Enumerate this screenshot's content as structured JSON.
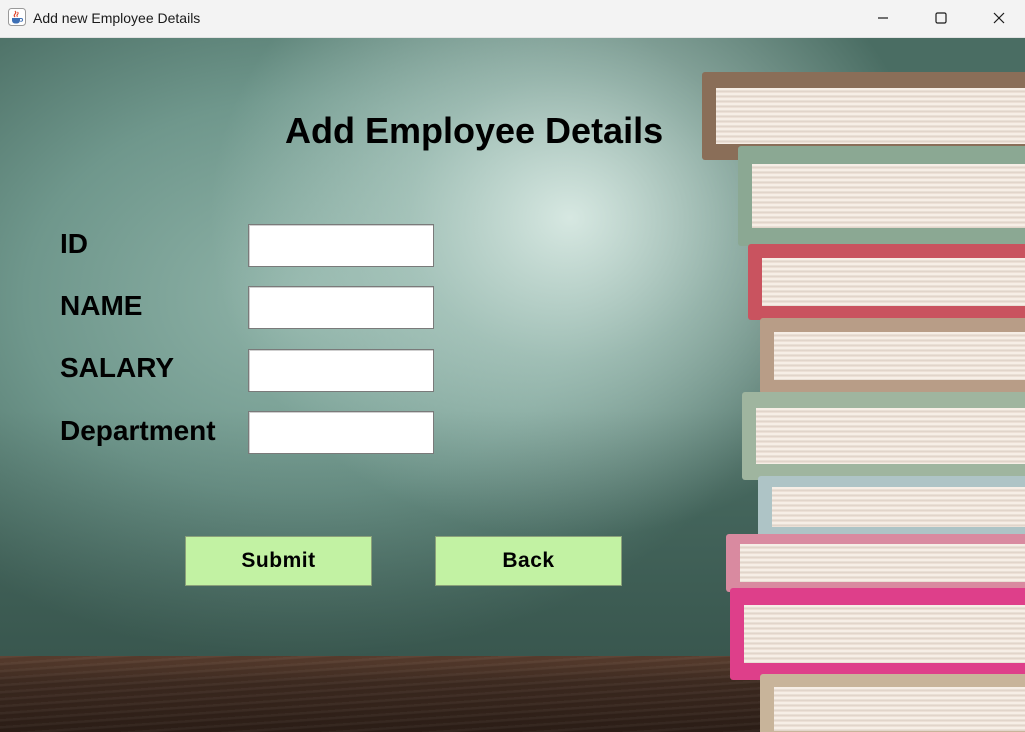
{
  "window": {
    "title": "Add new Employee Details"
  },
  "icons": {
    "app": "java-cup-icon",
    "minimize": "minimize-icon",
    "maximize": "maximize-icon",
    "close": "close-icon"
  },
  "form": {
    "heading": "Add Employee Details",
    "fields": [
      {
        "label": "ID",
        "value": "",
        "placeholder": ""
      },
      {
        "label": "NAME",
        "value": "",
        "placeholder": ""
      },
      {
        "label": "SALARY",
        "value": "",
        "placeholder": ""
      },
      {
        "label": "Department",
        "value": "",
        "placeholder": ""
      }
    ],
    "submit_label": "Submit",
    "back_label": "Back"
  },
  "colors": {
    "button_bg": "#c2f2a3",
    "board_green": "#6f978c",
    "table_brown": "#3d2a20"
  }
}
